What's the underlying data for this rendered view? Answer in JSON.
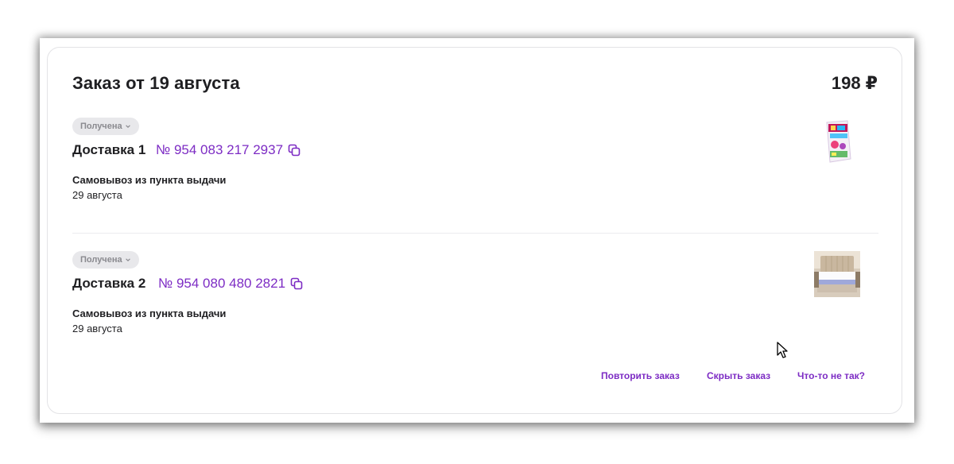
{
  "order": {
    "title": "Заказ от 19 августа",
    "total": "198 ₽"
  },
  "deliveries": [
    {
      "status": "Получена",
      "title": "Доставка 1",
      "tracking": "№ 954 083 217 2937",
      "method": "Самовывоз из пункта выдачи",
      "date": "29 августа",
      "thumbnail": "product-box-image"
    },
    {
      "status": "Получена",
      "title": "Доставка 2",
      "tracking": "№ 954 080 480 2821",
      "method": "Самовывоз из пункта выдачи",
      "date": "29 августа",
      "thumbnail": "mattress-image"
    }
  ],
  "actions": {
    "repeat": "Повторить заказ",
    "hide": "Скрыть заказ",
    "problem": "Что-то не так?"
  },
  "colors": {
    "accent": "#7d2cc4",
    "text": "#1f1f22",
    "badge_bg": "#e8e8eb",
    "badge_text": "#8a8a8f"
  }
}
